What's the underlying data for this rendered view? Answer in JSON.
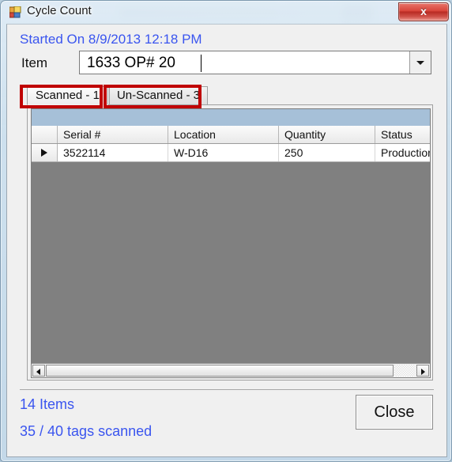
{
  "window": {
    "title": "Cycle Count",
    "app_icon": "form-icon",
    "close_label": "x"
  },
  "header": {
    "started_on": "Started On 8/9/2013 12:18 PM"
  },
  "item_row": {
    "label": "Item",
    "value": "1633  OP# 20",
    "placeholder": "",
    "dropdown_icon": "chevron-down-icon"
  },
  "tabs": [
    {
      "label": "Scanned - 1",
      "active": true
    },
    {
      "label": "Un-Scanned - 3",
      "active": false
    }
  ],
  "grid": {
    "columns": [
      "",
      "Serial #",
      "Location",
      "Quantity",
      "Status"
    ],
    "rows": [
      {
        "indicator": "row-indicator-triangle",
        "serial": "3522114",
        "location": "W-D16",
        "quantity": "250",
        "status": "Production"
      }
    ],
    "scrollbar": {
      "left_icon": "arrow-left-icon",
      "right_icon": "arrow-right-icon"
    }
  },
  "footer": {
    "items_count": "14 Items",
    "tags_scanned": "35 / 40 tags scanned",
    "close_button": "Close"
  },
  "colors": {
    "accent_text": "#3a55ef",
    "annotation": "#c00000",
    "grid_band": "#a6c0d8",
    "grid_body": "#808080",
    "close_button_red": "#d9453a"
  }
}
